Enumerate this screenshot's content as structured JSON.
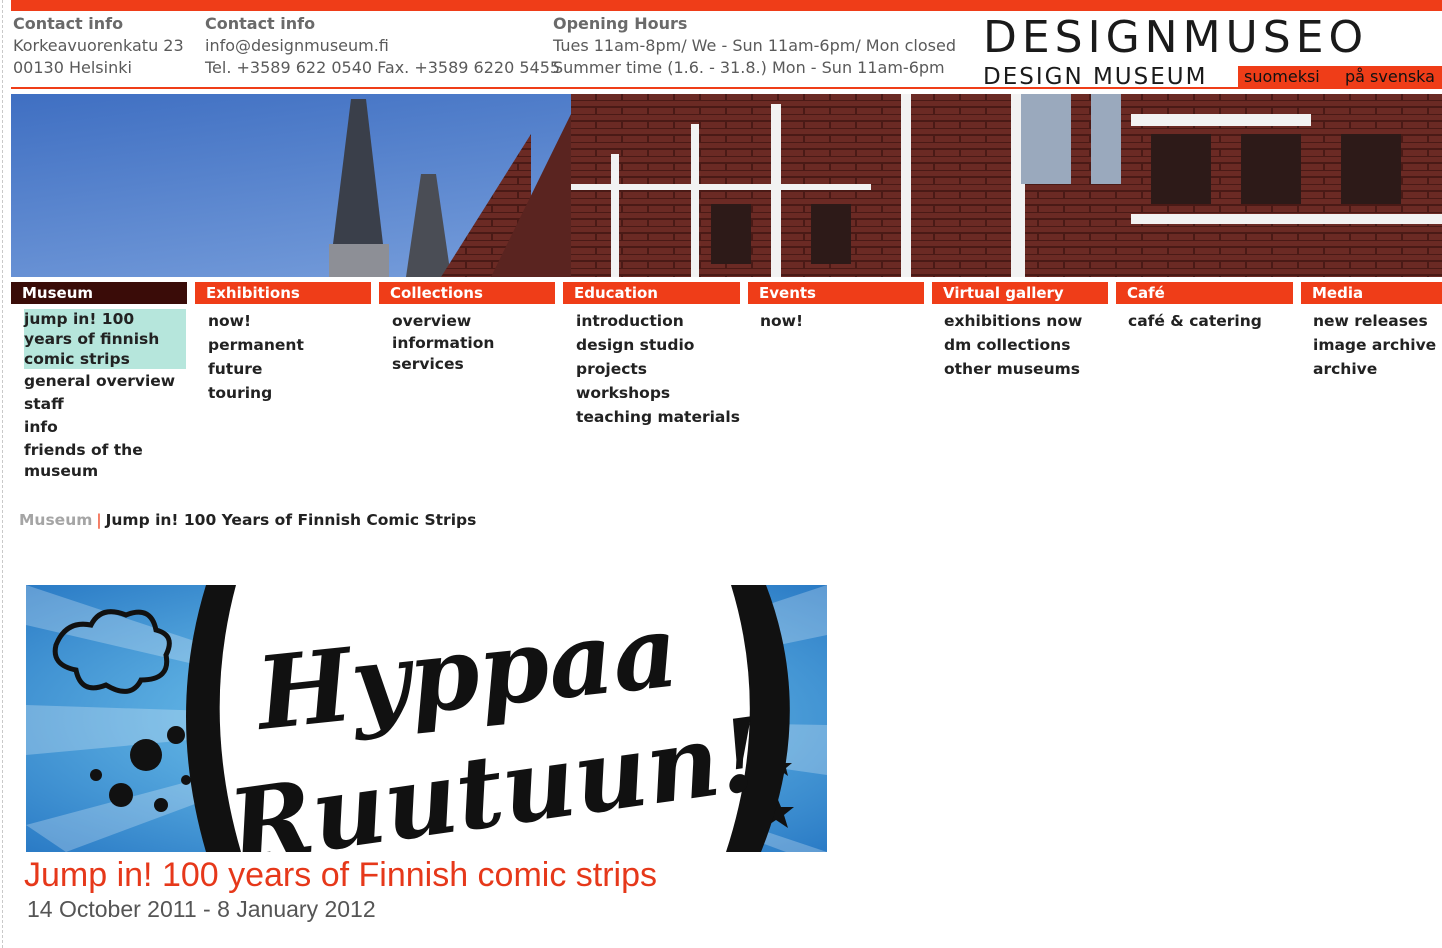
{
  "header": {
    "contact1": {
      "heading": "Contact info",
      "line1": "Korkeavuorenkatu 23",
      "line2": "00130 Helsinki"
    },
    "contact2": {
      "heading": "Contact info",
      "line1": "info@designmuseum.fi",
      "line2": "Tel. +3589 622 0540 Fax. +3589 6220 5455"
    },
    "hours": {
      "heading": "Opening Hours",
      "line1": "Tues 11am-8pm/ We - Sun 11am-6pm/ Mon closed",
      "line2": "Summer time (1.6. - 31.8.) Mon - Sun 11am-6pm"
    },
    "logo_main": "DESIGNMUSEO",
    "logo_sub": "DESIGN MUSEUM",
    "lang_fi": "suomeksi",
    "lang_sv": "på svenska"
  },
  "nav": {
    "museum": {
      "label": "Museum",
      "items": [
        "jump in! 100 years of finnish comic strips",
        "general overview",
        "staff",
        "info",
        "friends of the museum"
      ]
    },
    "exhibitions": {
      "label": "Exhibitions",
      "items": [
        "now!",
        "permanent",
        "future",
        "touring"
      ]
    },
    "collections": {
      "label": "Collections",
      "items": [
        "overview",
        "information services"
      ]
    },
    "education": {
      "label": "Education",
      "items": [
        "introduction",
        "design studio",
        "projects",
        "workshops",
        "teaching materials"
      ]
    },
    "events": {
      "label": "Events",
      "items": [
        "now!"
      ]
    },
    "virtual": {
      "label": "Virtual gallery",
      "items": [
        "exhibitions now",
        "dm collections",
        "other museums"
      ]
    },
    "cafe": {
      "label": "Café",
      "items": [
        "café & catering"
      ]
    },
    "media": {
      "label": "Media",
      "items": [
        "new releases",
        "image archive",
        "archive"
      ]
    }
  },
  "breadcrumb": {
    "root": "Museum",
    "sep": "|",
    "current": "Jump in! 100 Years of Finnish Comic Strips"
  },
  "banner": {
    "line1": "Hyppaa",
    "line2": "Ruutuun!"
  },
  "exhibition": {
    "title": "Jump in! 100 years of Finnish comic strips",
    "dates": "14 October 2011 - 8 January 2012"
  },
  "colors": {
    "accent": "#ef3d18",
    "nav_active": "#3a0c08",
    "highlight": "#b6e6dc"
  }
}
